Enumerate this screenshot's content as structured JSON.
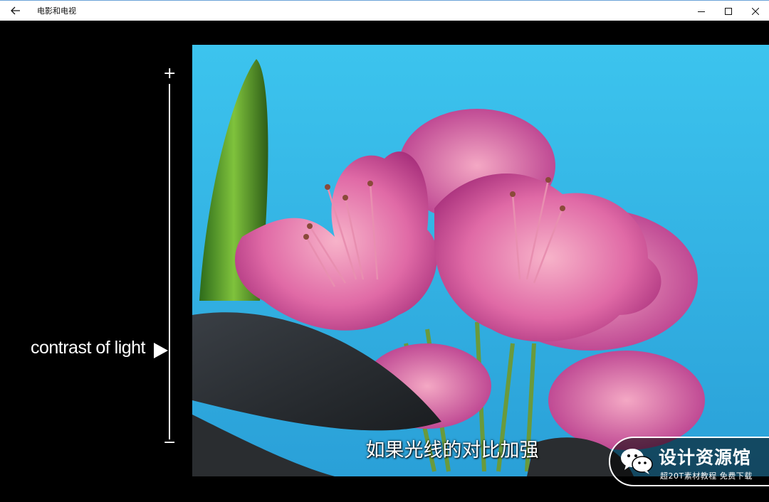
{
  "window": {
    "title": "电影和电视",
    "icons": {
      "back": "back-arrow-icon",
      "minimize": "minimize-icon",
      "maximize": "maximize-icon",
      "close": "close-icon"
    }
  },
  "overlay": {
    "scale_top": "+",
    "scale_bottom": "−",
    "label": "contrast of light",
    "pointer_icon": "triangle-right-icon"
  },
  "video": {
    "subtitle": "如果光线的对比加强",
    "colors": {
      "sky": "#39b9e8",
      "petal": "#e66aa8",
      "leaf": "#4f8f2c"
    }
  },
  "watermark": {
    "title": "设计资源馆",
    "subtitle": "超20T素材教程 免费下载"
  }
}
